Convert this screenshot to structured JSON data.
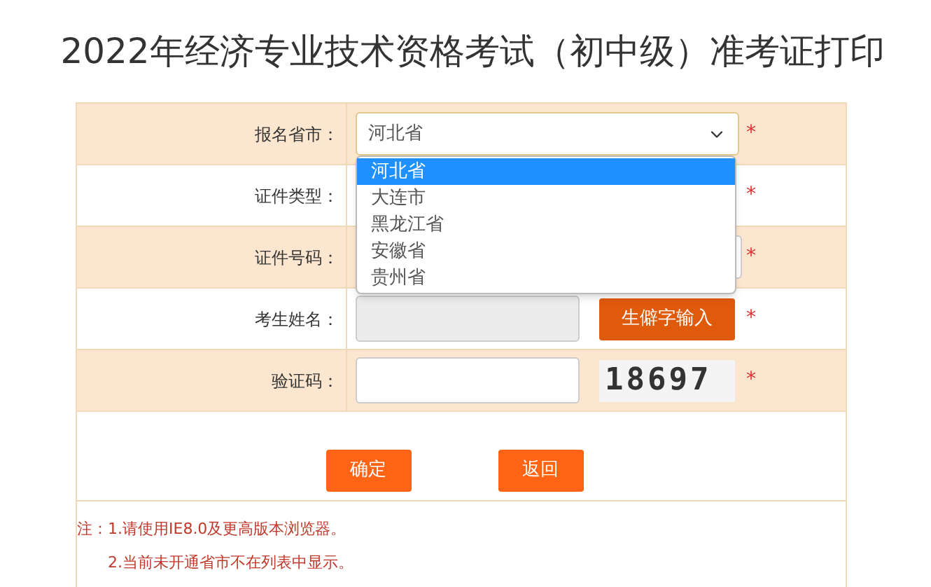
{
  "title": "2022年经济专业技术资格考试（初中级）准考证打印",
  "rows": [
    {
      "label": "报名省市：",
      "kind": "select",
      "value": "河北省",
      "required": "*"
    },
    {
      "label": "证件类型：",
      "kind": "hidden",
      "required": "*"
    },
    {
      "label": "证件号码：",
      "kind": "input-wide",
      "required": "*"
    },
    {
      "label": "考生姓名：",
      "kind": "input-button",
      "button": "生僻字输入",
      "disabled": true,
      "required": "*"
    },
    {
      "label": "验证码：",
      "kind": "captcha",
      "captcha": "18697",
      "required": "*"
    }
  ],
  "dropdown": [
    {
      "label": "河北省",
      "selected": true
    },
    {
      "label": "大连市",
      "selected": false
    },
    {
      "label": "黑龙江省",
      "selected": false
    },
    {
      "label": "安徽省",
      "selected": false
    },
    {
      "label": "贵州省",
      "selected": false
    }
  ],
  "buttons": [
    "确定",
    "返回"
  ],
  "notes": [
    "注：1.请使用IE8.0及更高版本浏览器。",
    "2.当前未开通省市不在列表中显示。"
  ]
}
